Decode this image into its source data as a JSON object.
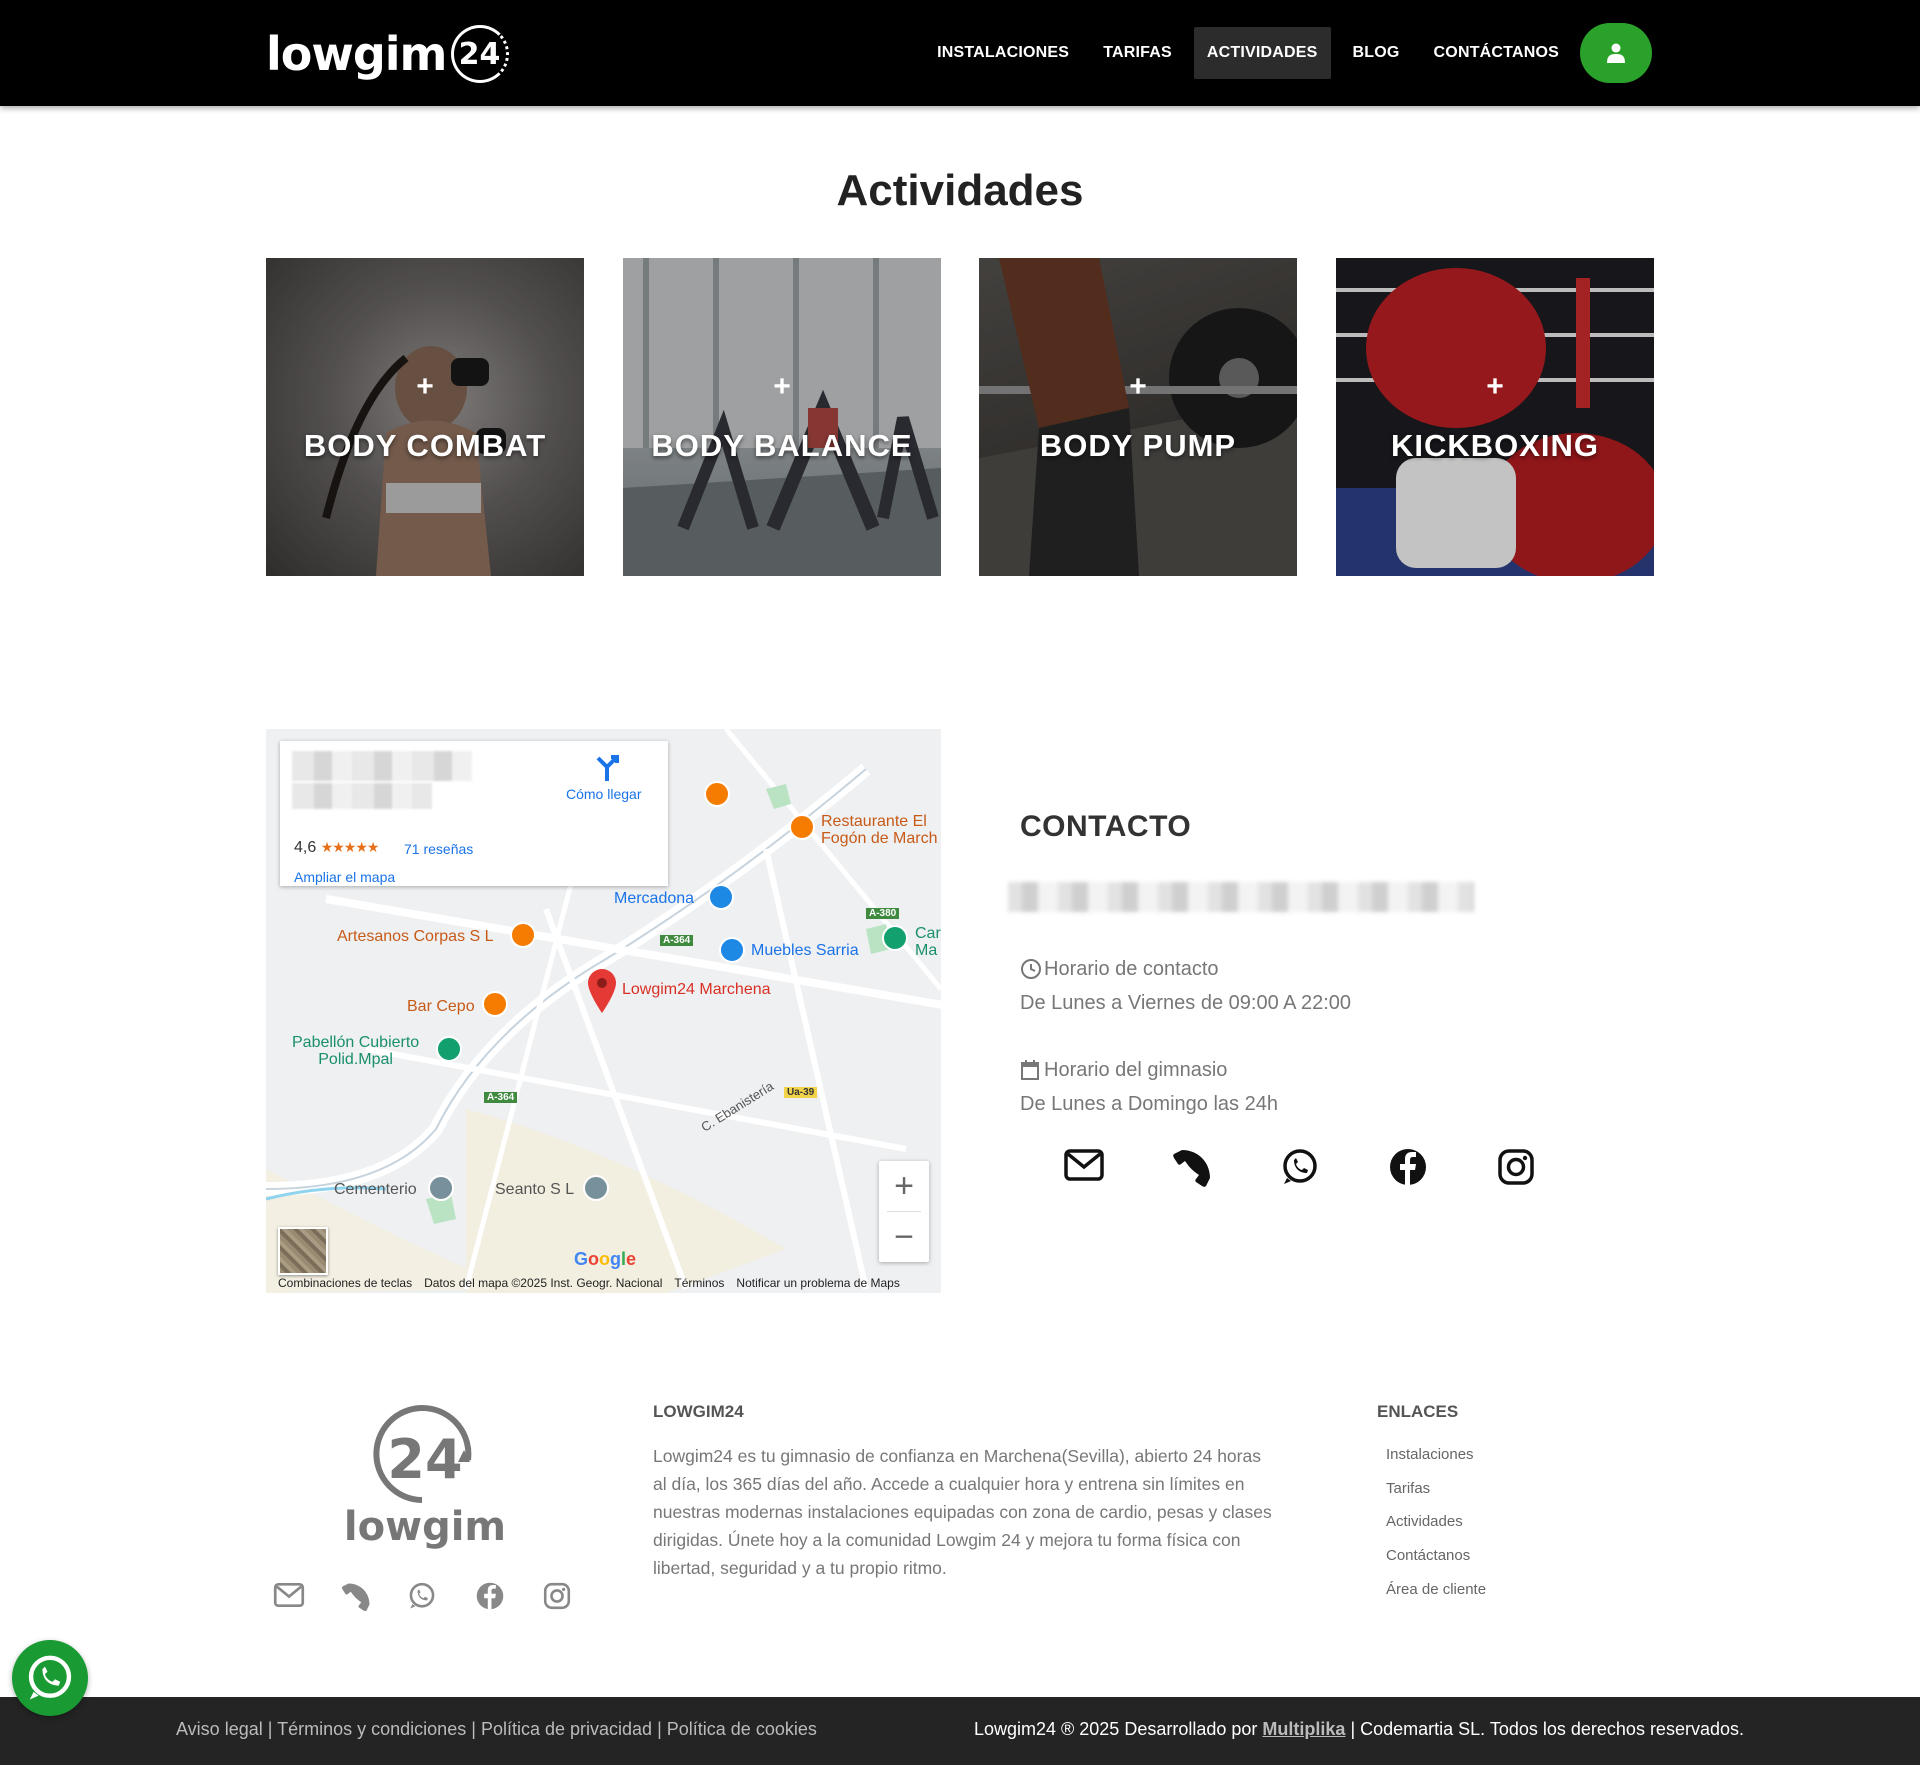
{
  "header": {
    "logo_text": "lowgim",
    "logo_number": "24",
    "nav": [
      "INSTALACIONES",
      "TARIFAS",
      "ACTIVIDADES",
      "BLOG",
      "CONTÁCTANOS"
    ],
    "active_nav": "ACTIVIDADES",
    "user_icon": "user-icon"
  },
  "activities": {
    "title": "Actividades",
    "plus": "+",
    "cards": [
      {
        "label": "BODY COMBAT"
      },
      {
        "label": "BODY BALANCE"
      },
      {
        "label": "BODY PUMP"
      },
      {
        "label": "KICKBOXING"
      }
    ]
  },
  "map": {
    "directions": "Cómo llegar",
    "rating": "4,6",
    "reviews": "71 reseñas",
    "enlarge": "Ampliar el mapa",
    "places": {
      "restaurante": "Restaurante El",
      "restaurante2": "Fogón de March",
      "mercadona": "Mercadona",
      "artesanos": "Artesanos Corpas S L",
      "muebles": "Muebles Sarria",
      "car": "Car",
      "car2": "Ma",
      "lowgim": "Lowgim24 Marchena",
      "bar": "Bar Cepo",
      "pabellon": "Pabellón Cubierto",
      "pabellon2": "Polid.Mpal",
      "cementerio": "Cementerio",
      "seanto": "Seanto S L",
      "ebanisteria": "C. Ebanistería",
      "a364a": "A-364",
      "a364b": "A-364",
      "a380": "A-380",
      "ua39": "Ua-39"
    },
    "google": "Google",
    "footer": [
      "Combinaciones de teclas",
      "Datos del mapa ©2025 Inst. Geogr. Nacional",
      "Términos",
      "Notificar un problema de Maps"
    ],
    "zoom_in": "+",
    "zoom_out": "−"
  },
  "contact": {
    "title": "CONTACTO",
    "contact_hours_label": "Horario de contacto",
    "contact_hours": "De Lunes a Viernes de 09:00 A 22:00",
    "gym_hours_label": "Horario del gimnasio",
    "gym_hours": "De Lunes a Domingo las 24h",
    "icons": [
      "envelope-icon",
      "phone-icon",
      "whatsapp-icon",
      "facebook-icon",
      "instagram-icon"
    ]
  },
  "footer": {
    "logo_number": "24",
    "logo_text": "lowgim",
    "about_title": "LOWGIM24",
    "about_text": "Lowgim24 es tu gimnasio de confianza en Marchena(Sevilla), abierto 24 horas al día, los 365 días del año. Accede a cualquier hora y entrena sin límites en nuestras modernas instalaciones equipadas con zona de cardio, pesas y clases dirigidas. Únete hoy a la comunidad Lowgim 24 y mejora tu forma física con libertad, seguridad y a tu propio ritmo.",
    "links_title": "ENLACES",
    "links": [
      "Instalaciones",
      "Tarifas",
      "Actividades",
      "Contáctanos",
      "Área de cliente"
    ]
  },
  "bottom": {
    "legal": [
      "Aviso legal",
      "Términos y condiciones",
      "Política de privacidad",
      "Política de cookies"
    ],
    "separator": "|",
    "copyright_prefix": "Lowgim24 ® 2025 Desarrollado por",
    "brand": "Multiplika",
    "copyright_suffix": "| Codemartia SL. Todos los derechos reservados."
  },
  "colors": {
    "header_bg": "#000000",
    "accent_green": "#2aa12a",
    "whatsapp_green": "#1a9a33",
    "map_pin": "#e53935",
    "bottom_bar": "#242424"
  }
}
